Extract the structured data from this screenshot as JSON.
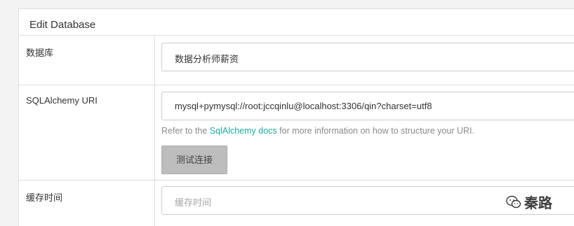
{
  "panel": {
    "title": "Edit Database"
  },
  "fields": {
    "database": {
      "label": "数据库",
      "value": "数据分析师薪资"
    },
    "uri": {
      "label": "SQLAlchemy URI",
      "value": "mysql+pymysql://root:jccqinlu@localhost:3306/qin?charset=utf8",
      "help_prefix": "Refer to the ",
      "help_link": "SqlAlchemy docs",
      "help_suffix": " for more information on how to structure your URI.",
      "test_button": "测试连接"
    },
    "cache": {
      "label": "缓存时间",
      "placeholder": "缓存时间"
    }
  },
  "watermark": {
    "icon": "wechat-icon",
    "text": "秦路"
  },
  "colors": {
    "link": "#20a7a0",
    "button_bg": "#bdbdbd",
    "border": "#dddddd"
  }
}
